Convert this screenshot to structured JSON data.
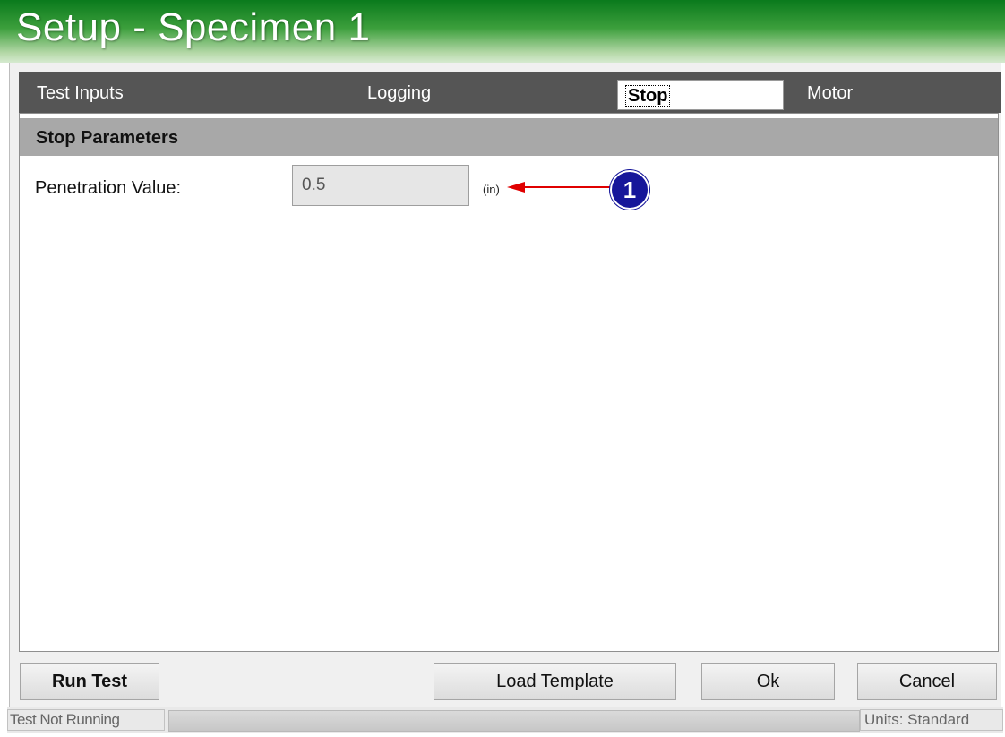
{
  "window": {
    "title": "Setup - Specimen 1"
  },
  "tabs": [
    {
      "label": "Test Inputs"
    },
    {
      "label": "Logging"
    },
    {
      "label": "Stop"
    },
    {
      "label": "Motor"
    }
  ],
  "active_tab": "Stop",
  "section": {
    "header": "Stop Parameters",
    "fields": [
      {
        "label": "Penetration Value:",
        "value": "0.5",
        "unit": "(in)"
      }
    ]
  },
  "annotation": {
    "callout_number": "1",
    "color": "#16169a",
    "arrow_color": "#e00000"
  },
  "buttons": {
    "run_test": "Run Test",
    "load_template": "Load Template",
    "ok": "Ok",
    "cancel": "Cancel"
  },
  "status": {
    "left": "Test Not Running",
    "right": "Units: Standard"
  },
  "colors": {
    "title_green": "#0a7a1c",
    "tab_bar": "#555555",
    "section_header": "#a8a8a8"
  }
}
